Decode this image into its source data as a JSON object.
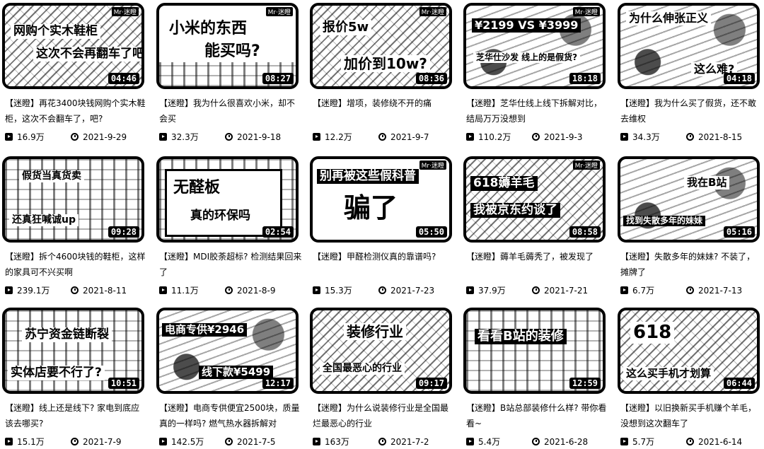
{
  "videos": [
    {
      "thumb_lines": [
        "网购个实木鞋柜",
        "这次不会再翻车了吧"
      ],
      "duration": "04:46",
      "title": "【迷瞪】再花3400块钱网购个实木鞋柜，这次不会翻车了，吧?",
      "views": "16.9万",
      "date": "2021-9-29"
    },
    {
      "thumb_lines": [
        "小米的东西",
        "能买吗?"
      ],
      "duration": "08:27",
      "title": "【迷瞪】我为什么很喜欢小米，却不会买",
      "views": "32.3万",
      "date": "2021-9-18"
    },
    {
      "thumb_lines": [
        "报价5w",
        "加价到10w?"
      ],
      "duration": "08:36",
      "title": "【迷瞪】增项，装修绕不开的痛",
      "views": "12.2万",
      "date": "2021-9-7"
    },
    {
      "thumb_lines": [
        "¥2199 VS ¥3999",
        "芝华仕沙发 线上的是假货?"
      ],
      "duration": "18:18",
      "title": "【迷瞪】芝华仕线上线下拆解对比，结局万万没想到",
      "views": "110.2万",
      "date": "2021-9-3"
    },
    {
      "thumb_lines": [
        "为什么伸张正义",
        "这么难?"
      ],
      "duration": "04:18",
      "title": "【迷瞪】我为什么买了假货，还不敢去维权",
      "views": "34.3万",
      "date": "2021-8-15"
    },
    {
      "thumb_lines": [
        "假货当真货卖",
        "还真狂喊诚up"
      ],
      "duration": "09:28",
      "title": "【迷瞪】拆个4600块钱的鞋柜，这样的家具可不兴买啊",
      "views": "239.1万",
      "date": "2021-8-11"
    },
    {
      "thumb_lines": [
        "无醛板",
        "真的环保吗"
      ],
      "duration": "02:54",
      "title": "【迷瞪】MDI胶荼超标? 检测结果回来了",
      "views": "11.1万",
      "date": "2021-8-9"
    },
    {
      "thumb_lines": [
        "别再被这些假科普",
        "骗了"
      ],
      "duration": "05:50",
      "title": "【迷瞪】甲醛检测仪真的靠谱吗?",
      "views": "15.3万",
      "date": "2021-7-23"
    },
    {
      "thumb_lines": [
        "618薅羊毛",
        "我被京东约谈了"
      ],
      "duration": "08:58",
      "title": "【迷瞪】薅羊毛薅秃了，被发现了",
      "views": "37.9万",
      "date": "2021-7-21"
    },
    {
      "thumb_lines": [
        "我在B站",
        "找到失散多年的妹妹"
      ],
      "duration": "05:16",
      "title": "【迷瞪】失散多年的妹妹? 不装了，摊牌了",
      "views": "6.7万",
      "date": "2021-7-13"
    },
    {
      "thumb_lines": [
        "苏宁资金链断裂",
        "实体店要不行了?"
      ],
      "duration": "10:51",
      "title": "【迷瞪】线上还是线下? 家电到底应该去哪买?",
      "views": "15.1万",
      "date": "2021-7-9"
    },
    {
      "thumb_lines": [
        "电商专供¥2946",
        "线下款¥5499"
      ],
      "duration": "12:17",
      "title": "【迷瞪】电商专供便宜2500块，质量真的一样吗? 燃气热水器拆解对",
      "views": "142.5万",
      "date": "2021-7-5"
    },
    {
      "thumb_lines": [
        "装修行业",
        "全国最恶心的行业"
      ],
      "duration": "09:17",
      "title": "【迷瞪】为什么说装修行业是全国最烂最恶心的行业",
      "views": "163万",
      "date": "2021-7-2"
    },
    {
      "thumb_lines": [
        "看看B站的装修"
      ],
      "duration": "12:59",
      "title": "【迷瞪】B站总部装修什么样? 带你看看~",
      "views": "5.4万",
      "date": "2021-6-28"
    },
    {
      "thumb_lines": [
        "618",
        "这么买手机才划算"
      ],
      "duration": "06:44",
      "title": "【迷瞪】以旧换新买手机赚个羊毛，没想到这次翻车了",
      "views": "5.7万",
      "date": "2021-6-14"
    }
  ],
  "watermark": "Mr·迷瞪",
  "icons": {
    "views": "play-count-icon",
    "date": "clock-icon"
  }
}
